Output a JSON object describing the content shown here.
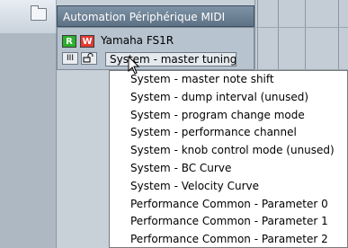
{
  "header": {
    "title": "Automation Périphérique MIDI"
  },
  "track": {
    "read_label": "R",
    "write_label": "W",
    "device_name": "Yamaha FS1R",
    "bars_label": "III",
    "selected_parameter": "System - master tuning"
  },
  "menu": {
    "items": [
      "System - master note shift",
      "System - dump interval (unused)",
      "System - program change mode",
      "System - performance channel",
      "System - knob control mode (unused)",
      "System - BC Curve",
      "System - Velocity Curve",
      "Performance Common - Parameter 0",
      "Performance Common - Parameter 1",
      "Performance Common - Parameter 2"
    ]
  },
  "colors": {
    "read_button": "#2bb02b",
    "write_button": "#e23a32",
    "header_bar": "#6b7f93"
  }
}
